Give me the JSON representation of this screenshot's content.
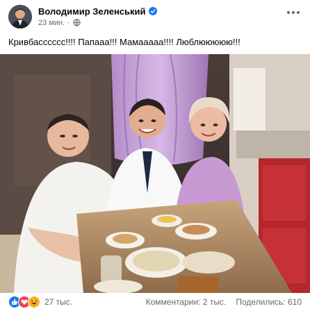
{
  "post": {
    "author": "Володимир Зеленський",
    "time": "23 мин.",
    "text": "Кривбасссссс!!!! Папааа!!! Мамааааа!!!! Люблююююю!!!"
  },
  "footer": {
    "reactions_count": "27 тыс.",
    "comments": "Комментарии: 2 тыс.",
    "shares": "Поделились: 610"
  },
  "colors": {
    "accent": "#1877f2",
    "secondary_text": "#65676b",
    "like": "#1877f2",
    "love": "#f33e58",
    "haha": "#f7b125"
  },
  "icons": [
    "verified-badge-icon",
    "globe-icon",
    "more-options-icon",
    "like-reaction-icon",
    "love-reaction-icon",
    "haha-reaction-icon"
  ]
}
